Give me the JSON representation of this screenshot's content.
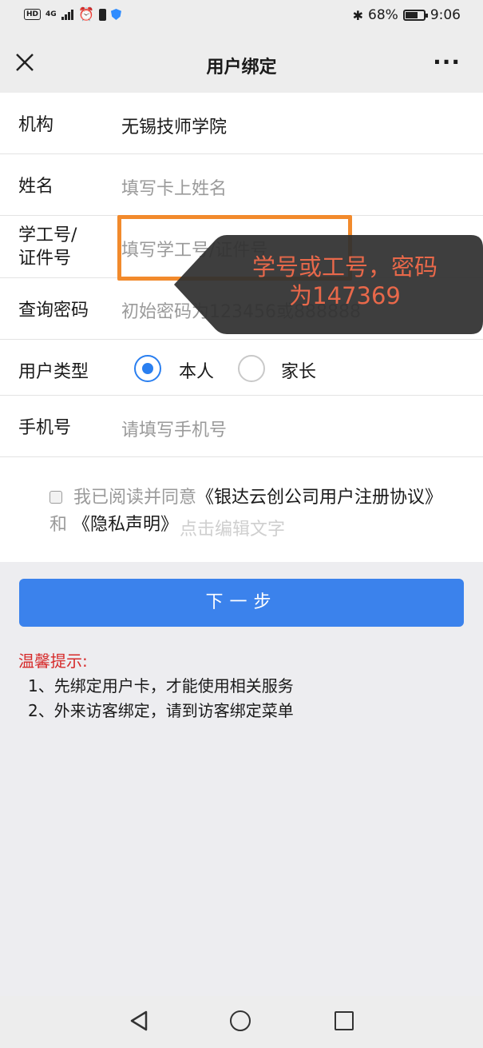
{
  "status_bar": {
    "left_badge": "HD",
    "network": "4G",
    "battery_percent": "68%",
    "battery_level": 0.68,
    "time": "9:06",
    "icons": [
      "hd-icon",
      "signal-icon",
      "alarm-icon",
      "phone-icon",
      "shield-icon",
      "bluetooth-icon",
      "battery-icon"
    ]
  },
  "nav": {
    "title": "用户绑定",
    "more": "···"
  },
  "form": {
    "org": {
      "label": "机构",
      "value": "无锡技师学院"
    },
    "name": {
      "label": "姓名",
      "placeholder": "填写卡上姓名"
    },
    "id": {
      "label_line1": "学工号/",
      "label_line2": "证件号",
      "placeholder": "填写学工号/证件号"
    },
    "password": {
      "label": "查询密码",
      "placeholder": "初始密码为123456或888888"
    },
    "user_type": {
      "label": "用户类型",
      "options": [
        "本人",
        "家长"
      ],
      "selected": "本人"
    },
    "phone": {
      "label": "手机号",
      "placeholder": "请填写手机号"
    }
  },
  "agreement": {
    "prefix": "我已阅读并同意",
    "link1": "《银达云创公司用户注册协议》",
    "and": "和",
    "link2": "《隐私声明》",
    "checked": false
  },
  "watermark": "点击编辑文字",
  "next_button": "下一步",
  "tips": {
    "title": "温馨提示:",
    "items": [
      "1、先绑定用户卡，才能使用相关服务",
      "2、外来访客绑定，请到访客绑定菜单"
    ]
  },
  "annotation": {
    "line1": "学号或工号，密码",
    "line2": "为147369",
    "highlight_color": "#f28a2c",
    "text_color": "#e8684a"
  },
  "colors": {
    "accent": "#3b82ec",
    "warning": "#d62a2a"
  }
}
